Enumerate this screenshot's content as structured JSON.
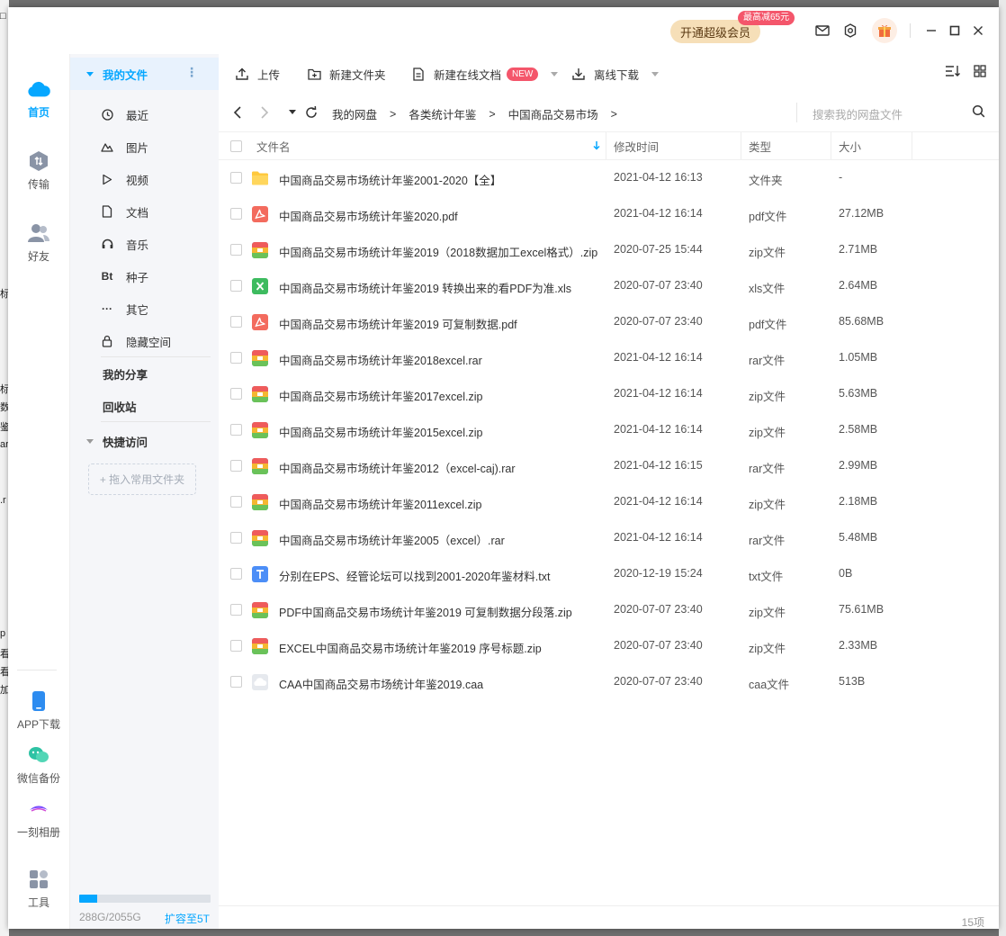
{
  "background": {
    "left_fragments": [
      "□",
      "标",
      "标",
      "数",
      "鉴",
      "ar",
      ".r",
      "p",
      "看",
      "看",
      "加"
    ]
  },
  "titlebar": {
    "vip_button": "开通超级会员",
    "vip_badge": "最高减65元",
    "icons": [
      "mail-icon",
      "settings-icon",
      "gift-icon",
      "minimize-icon",
      "maximize-icon",
      "close-icon"
    ]
  },
  "leftnav": {
    "items": [
      {
        "label": "首页",
        "icon": "cloud-icon",
        "active": true
      },
      {
        "label": "传输",
        "icon": "transfer-icon"
      },
      {
        "label": "好友",
        "icon": "friends-icon"
      }
    ],
    "bottom_items": [
      {
        "label": "APP下载",
        "icon": "phone-icon"
      },
      {
        "label": "微信备份",
        "icon": "wechat-icon"
      },
      {
        "label": "一刻相册",
        "icon": "album-icon"
      },
      {
        "label": "工具",
        "icon": "tools-icon"
      }
    ]
  },
  "sidebar": {
    "my_files": "我的文件",
    "more": "⋮",
    "categories": [
      {
        "label": "最近",
        "icon": "clock-icon"
      },
      {
        "label": "图片",
        "icon": "image-icon"
      },
      {
        "label": "视频",
        "icon": "play-icon"
      },
      {
        "label": "文档",
        "icon": "doc-icon"
      },
      {
        "label": "音乐",
        "icon": "headphone-icon"
      },
      {
        "label": "种子",
        "icon": "bt-icon",
        "glyph": "Bt"
      },
      {
        "label": "其它",
        "icon": "more-icon",
        "glyph": "···"
      },
      {
        "label": "隐藏空间",
        "icon": "lock-icon"
      }
    ],
    "my_share": "我的分享",
    "recycle": "回收站",
    "quick_access": "快捷访问",
    "drop_hint": "+ 拖入常用文件夹",
    "quota_text": "288G/2055G",
    "quota_used_fraction": 0.14,
    "expand": "扩容至5T"
  },
  "toolbar": {
    "upload": "上传",
    "new_folder": "新建文件夹",
    "new_online_doc": "新建在线文档",
    "new_badge": "NEW",
    "offline_download": "离线下载"
  },
  "breadcrumb": {
    "items": [
      "我的网盘",
      "各类统计年鉴",
      "中国商品交易市场"
    ],
    "separator": ">",
    "search_placeholder": "搜索我的网盘文件"
  },
  "table": {
    "headers": {
      "name": "文件名",
      "modified": "修改时间",
      "type": "类型",
      "size": "大小"
    },
    "rows": [
      {
        "name": "中国商品交易市场统计年鉴2001-2020【全】",
        "time": "2021-04-12 16:13",
        "type": "文件夹",
        "size": "-",
        "icon": "folder"
      },
      {
        "name": "中国商品交易市场统计年鉴2020.pdf",
        "time": "2021-04-12 16:14",
        "type": "pdf文件",
        "size": "27.12MB",
        "icon": "pdf"
      },
      {
        "name": "中国商品交易市场统计年鉴2019（2018数据加工excel格式）.zip",
        "time": "2020-07-25 15:44",
        "type": "zip文件",
        "size": "2.71MB",
        "icon": "zip"
      },
      {
        "name": "中国商品交易市场统计年鉴2019 转换出来的看PDF为准.xls",
        "time": "2020-07-07 23:40",
        "type": "xls文件",
        "size": "2.64MB",
        "icon": "xls"
      },
      {
        "name": "中国商品交易市场统计年鉴2019 可复制数据.pdf",
        "time": "2020-07-07 23:40",
        "type": "pdf文件",
        "size": "85.68MB",
        "icon": "pdf"
      },
      {
        "name": "中国商品交易市场统计年鉴2018excel.rar",
        "time": "2021-04-12 16:14",
        "type": "rar文件",
        "size": "1.05MB",
        "icon": "zip"
      },
      {
        "name": "中国商品交易市场统计年鉴2017excel.zip",
        "time": "2021-04-12 16:14",
        "type": "zip文件",
        "size": "5.63MB",
        "icon": "zip"
      },
      {
        "name": "中国商品交易市场统计年鉴2015excel.zip",
        "time": "2021-04-12 16:14",
        "type": "zip文件",
        "size": "2.58MB",
        "icon": "zip"
      },
      {
        "name": "中国商品交易市场统计年鉴2012（excel-caj).rar",
        "time": "2021-04-12 16:15",
        "type": "rar文件",
        "size": "2.99MB",
        "icon": "zip"
      },
      {
        "name": "中国商品交易市场统计年鉴2011excel.zip",
        "time": "2021-04-12 16:14",
        "type": "zip文件",
        "size": "2.18MB",
        "icon": "zip"
      },
      {
        "name": "中国商品交易市场统计年鉴2005（excel）.rar",
        "time": "2021-04-12 16:14",
        "type": "rar文件",
        "size": "5.48MB",
        "icon": "zip"
      },
      {
        "name": "分别在EPS、经管论坛可以找到2001-2020年鉴材料.txt",
        "time": "2020-12-19 15:24",
        "type": "txt文件",
        "size": "0B",
        "icon": "txt"
      },
      {
        "name": "PDF中国商品交易市场统计年鉴2019 可复制数据分段落.zip",
        "time": "2020-07-07 23:40",
        "type": "zip文件",
        "size": "75.61MB",
        "icon": "zip"
      },
      {
        "name": "EXCEL中国商品交易市场统计年鉴2019 序号标题.zip",
        "time": "2020-07-07 23:40",
        "type": "zip文件",
        "size": "2.33MB",
        "icon": "zip"
      },
      {
        "name": "CAA中国商品交易市场统计年鉴2019.caa",
        "time": "2020-07-07 23:40",
        "type": "caa文件",
        "size": "513B",
        "icon": "caa"
      }
    ]
  },
  "status": {
    "count": "15项"
  },
  "colors": {
    "accent": "#06a7ff",
    "badge": "#f4566b",
    "vip_bg": "#f6dfb8"
  }
}
